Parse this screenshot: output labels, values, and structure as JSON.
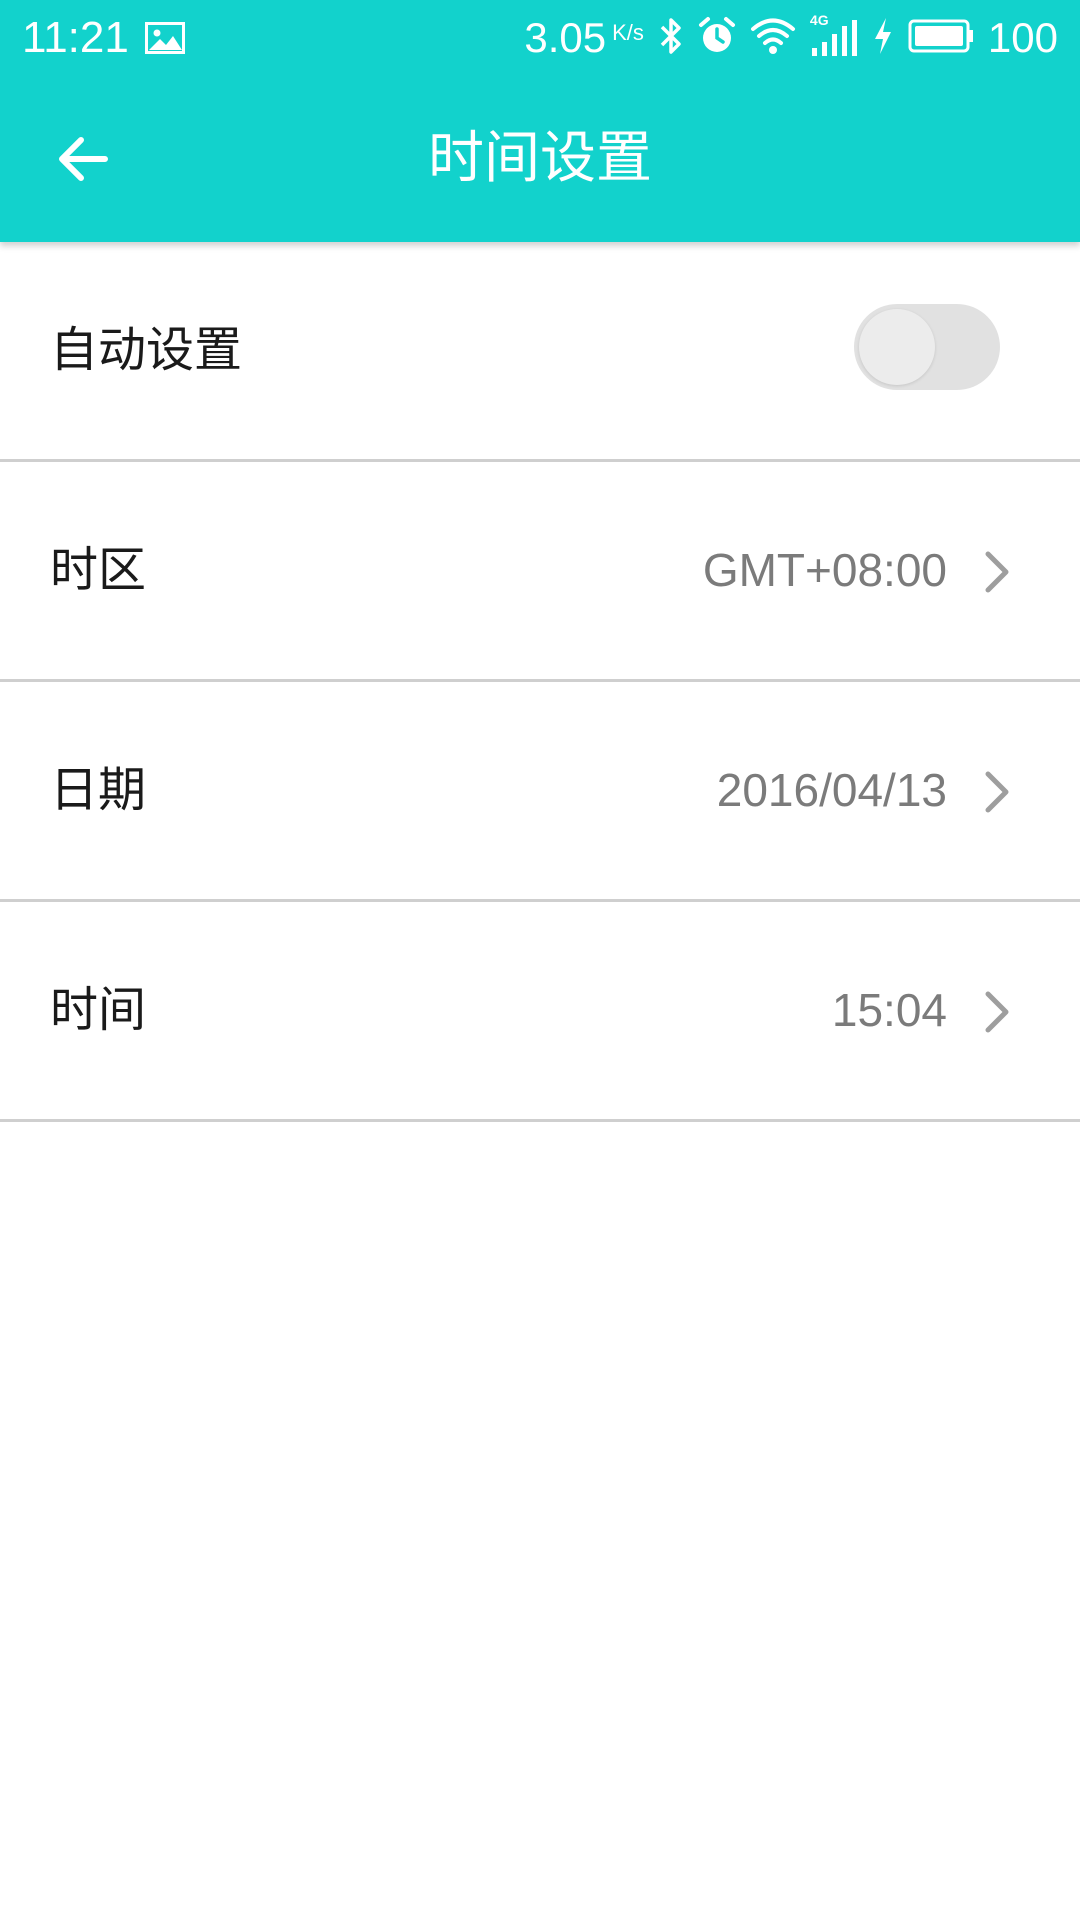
{
  "status_bar": {
    "time": "11:21",
    "network_speed": "3.05",
    "network_speed_unit": "K/s",
    "network_type": "4G",
    "battery_level": "100",
    "icons": [
      "image-icon",
      "bluetooth-icon",
      "alarm-icon",
      "wifi-icon",
      "signal-4g-icon",
      "charging-icon",
      "battery-icon"
    ]
  },
  "header": {
    "title": "时间设置",
    "back_icon": "arrow-left-icon",
    "background_color": "#12d2cc"
  },
  "settings": {
    "auto": {
      "label": "自动设置",
      "enabled": false
    },
    "timezone": {
      "label": "时区",
      "value": "GMT+08:00"
    },
    "date": {
      "label": "日期",
      "value": "2016/04/13"
    },
    "time": {
      "label": "时间",
      "value": "15:04"
    }
  }
}
